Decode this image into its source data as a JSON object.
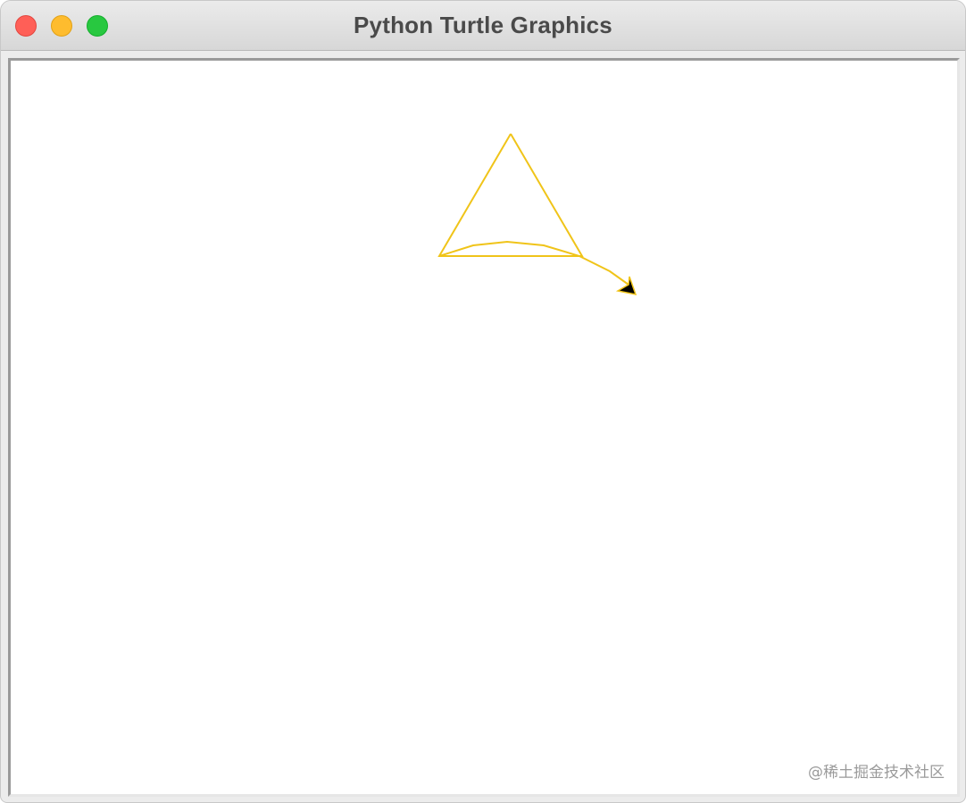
{
  "window": {
    "title": "Python Turtle Graphics"
  },
  "controls": {
    "close": "close-button",
    "minimize": "minimize-button",
    "zoom": "zoom-button"
  },
  "canvas": {
    "stroke_color": "#f0c419",
    "turtle_color": "#000000",
    "watermark": "@稀土掘金技术社区"
  },
  "colors": {
    "close": "#ff5f57",
    "minimize": "#febc2e",
    "zoom": "#28c840"
  }
}
